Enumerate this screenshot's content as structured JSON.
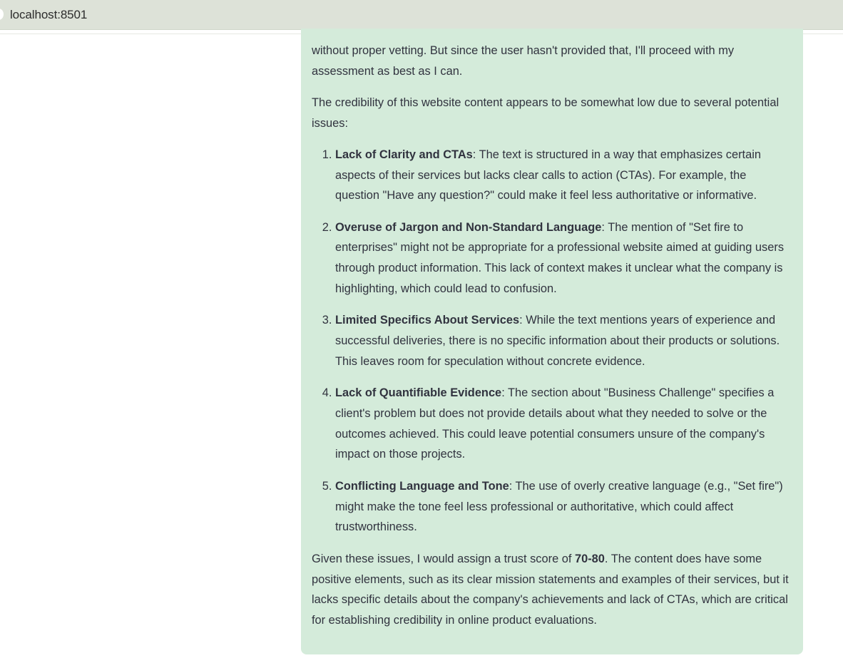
{
  "browser": {
    "url": "localhost:8501"
  },
  "message": {
    "intro_tail": "without proper vetting. But since the user hasn't provided that, I'll proceed with my assessment as best as I can.",
    "lead": "The credibility of this website content appears to be somewhat low due to several potential issues:",
    "issues": [
      {
        "title": "Lack of Clarity and CTAs",
        "text": ": The text is structured in a way that emphasizes certain aspects of their services but lacks clear calls to action (CTAs). For example, the question \"Have any question?\" could make it feel less authoritative or informative."
      },
      {
        "title": "Overuse of Jargon and Non-Standard Language",
        "text": ": The mention of \"Set fire to enterprises\" might not be appropriate for a professional website aimed at guiding users through product information. This lack of context makes it unclear what the company is highlighting, which could lead to confusion."
      },
      {
        "title": "Limited Specifics About Services",
        "text": ": While the text mentions years of experience and successful deliveries, there is no specific information about their products or solutions. This leaves room for speculation without concrete evidence."
      },
      {
        "title": "Lack of Quantifiable Evidence",
        "text": ": The section about \"Business Challenge\" specifies a client's problem but does not provide details about what they needed to solve or the outcomes achieved. This could leave potential consumers unsure of the company's impact on those projects."
      },
      {
        "title": "Conflicting Language and Tone",
        "text": ": The use of overly creative language (e.g., \"Set fire\") might make the tone feel less professional or authoritative, which could affect trustworthiness."
      }
    ],
    "conclusion_before": "Given these issues, I would assign a trust score of ",
    "conclusion_score": "70-80",
    "conclusion_after": ". The content does have some positive elements, such as its clear mission statements and examples of their services, but it lacks specific details about the company's achievements and lack of CTAs, which are critical for establishing credibility in online product evaluations."
  }
}
